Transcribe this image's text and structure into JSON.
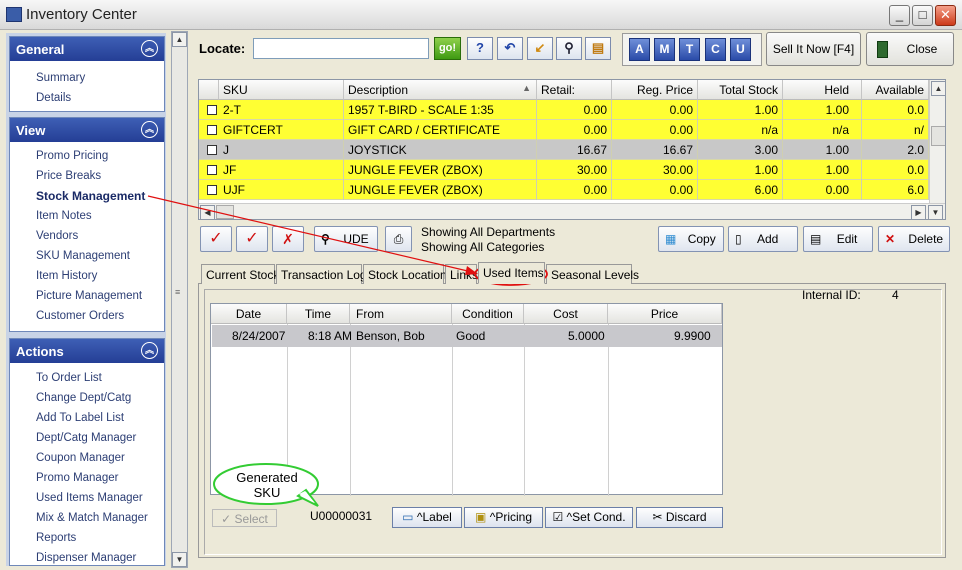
{
  "window": {
    "title": "Inventory Center"
  },
  "sidebar": {
    "general": {
      "title": "General",
      "items": [
        "Summary",
        "Details"
      ]
    },
    "view": {
      "title": "View",
      "items": [
        "Promo Pricing",
        "Price Breaks",
        "Stock Management",
        "Item Notes",
        "Vendors",
        "SKU Management",
        "Item History",
        "Picture Management",
        "Customer Orders"
      ],
      "active": "Stock Management"
    },
    "actions": {
      "title": "Actions",
      "items": [
        "To Order List",
        "Change Dept/Catg",
        "Add To Label List",
        "Dept/Catg Manager",
        "Coupon Manager",
        "Promo Manager",
        "Used Items Manager",
        "Mix & Match Manager",
        "Reports",
        "Dispenser Manager"
      ]
    }
  },
  "toolbar": {
    "locate_label": "Locate:",
    "locate_value": "",
    "go_label": "go!",
    "letters": [
      "A",
      "M",
      "T",
      "C",
      "U"
    ],
    "sell_label": "Sell It Now [F4]",
    "close_label": "Close"
  },
  "grid": {
    "columns": [
      "SKU",
      "Description",
      "Retail:",
      "Reg. Price",
      "Total Stock",
      "Held",
      "Available"
    ],
    "rows": [
      {
        "sku": "2-T",
        "description": "1957 T-BIRD - SCALE 1:35",
        "retail": "0.00",
        "reg_price": "0.00",
        "total_stock": "1.00",
        "held": "1.00",
        "available": "0.0",
        "color": "yellow"
      },
      {
        "sku": "GIFTCERT",
        "description": "GIFT CARD / CERTIFICATE",
        "retail": "0.00",
        "reg_price": "0.00",
        "total_stock": "n/a",
        "held": "n/a",
        "available": "n/",
        "color": "yellow"
      },
      {
        "sku": "J",
        "description": "JOYSTICK",
        "retail": "16.67",
        "reg_price": "16.67",
        "total_stock": "3.00",
        "held": "1.00",
        "available": "2.0",
        "color": "gray"
      },
      {
        "sku": "JF",
        "description": "JUNGLE FEVER (ZBOX)",
        "retail": "30.00",
        "reg_price": "30.00",
        "total_stock": "1.00",
        "held": "1.00",
        "available": "0.0",
        "color": "yellow"
      },
      {
        "sku": "UJF",
        "description": "JUNGLE FEVER (ZBOX)",
        "retail": "0.00",
        "reg_price": "0.00",
        "total_stock": "6.00",
        "held": "0.00",
        "available": "6.0",
        "color": "yellow"
      }
    ]
  },
  "actions_row": {
    "ude_label": "UDE",
    "showing_departments": "Showing All Departments",
    "showing_categories": "Showing All Categories",
    "copy_label": "Copy",
    "add_label": "Add",
    "edit_label": "Edit",
    "delete_label": "Delete"
  },
  "tabs": [
    "Current Stock",
    "Transaction Log",
    "Stock Location",
    "Links",
    "Used Items",
    "Seasonal Levels"
  ],
  "active_tab": "Used Items",
  "used_items": {
    "internal_id_label": "Internal ID:",
    "internal_id_value": "4",
    "columns": [
      "Date",
      "Time",
      "From",
      "Condition",
      "Cost",
      "Price"
    ],
    "rows": [
      {
        "date": "8/24/2007",
        "time": "8:18 AM",
        "from": "Benson, Bob",
        "condition": "Good",
        "cost": "5.0000",
        "price": "9.9900"
      }
    ],
    "select_label": "Select",
    "generated_sku": "U00000031",
    "label_btn": "^Label",
    "pricing_btn": "^Pricing",
    "setcond_btn": "^Set Cond.",
    "discard_btn": "Discard"
  },
  "callout": {
    "text_line1": "Generated",
    "text_line2": "SKU"
  },
  "colors": {
    "row_yellow": "#ffff33",
    "row_gray": "#c8c8c8",
    "annotation_red": "#e01010",
    "callout_green": "#33cc33"
  }
}
